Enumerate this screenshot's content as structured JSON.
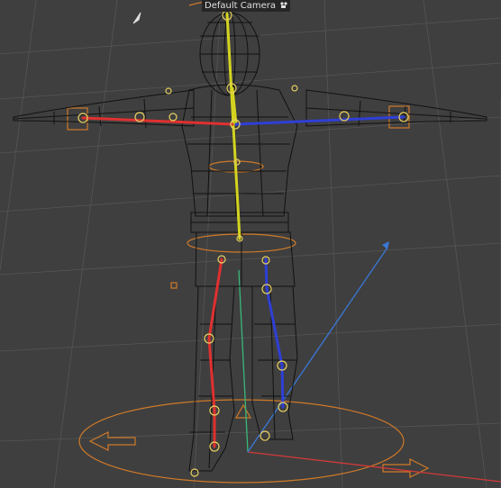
{
  "viewport": {
    "camera_label": "Default Camera",
    "camera_icon": "camera-icon"
  },
  "colors": {
    "background": "#3f3f3f",
    "grid": "#555555",
    "mesh_wire": "#111111",
    "bone_center": "#d4d420",
    "bone_left": "#e03030",
    "bone_right": "#2f3fd6",
    "joint": "#e8d060",
    "manipulator": "#d07a28",
    "axis_x": "#d13a3a",
    "axis_y": "#39b87a",
    "axis_z": "#3a78d8"
  }
}
